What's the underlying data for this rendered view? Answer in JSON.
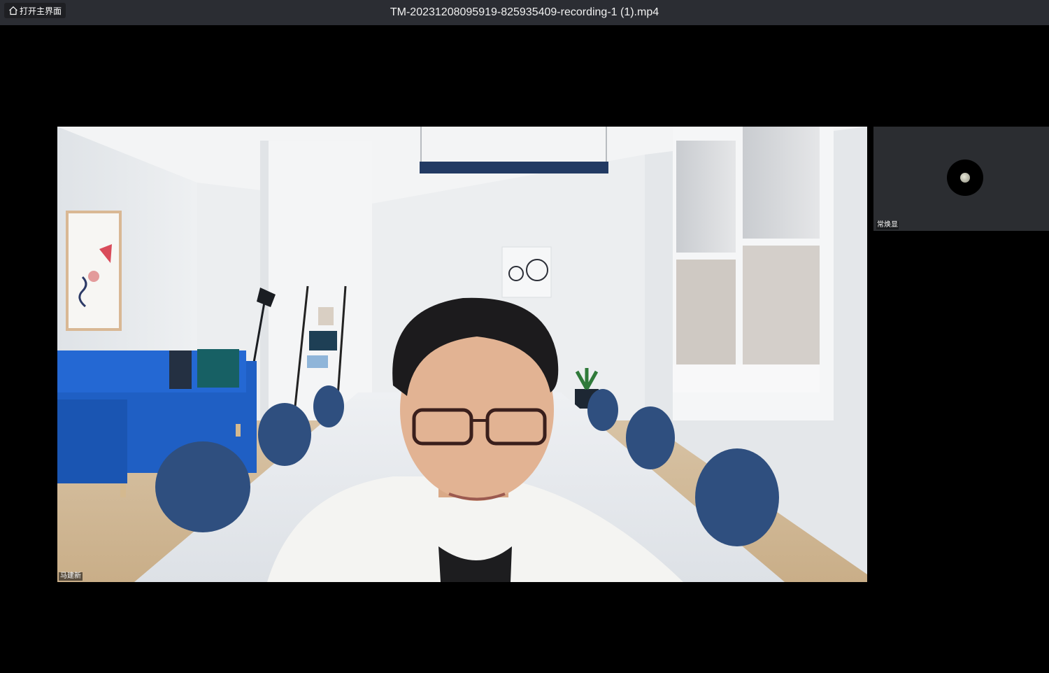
{
  "window": {
    "title": "TM-20231208095919-825935409-recording-1 (1).mp4",
    "home_button_label": "打开主界面",
    "home_icon": "home-icon"
  },
  "main_video": {
    "participant_name": "马建新"
  },
  "thumbnail": {
    "participant_name": "常焕显",
    "avatar_icon": "avatar-icon"
  },
  "colors": {
    "titlebar": "#2b2d33",
    "background": "#000000",
    "thumbnail_bg": "#2b2d31",
    "sofa": "#1f5fc4",
    "chairs": "#2f4f7f"
  }
}
